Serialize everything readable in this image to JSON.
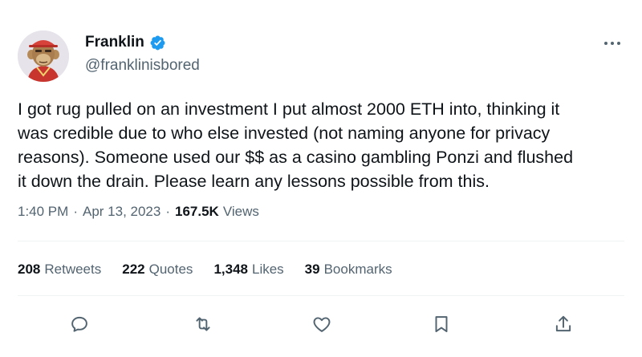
{
  "author": {
    "display_name": "Franklin",
    "handle": "@franklinisbored",
    "avatar_icon": "bored-ape-avatar",
    "verified": true,
    "verified_color": "#1d9bf0"
  },
  "tweet": {
    "text": "I got rug pulled on an investment I put almost 2000 ETH into, thinking it\nwas credible due to who else invested (not naming anyone for privacy\nreasons). Someone used our $$ as a casino gambling Ponzi and flushed\nit down the drain. Please learn any lessons possible from this.",
    "time": "1:40 PM",
    "separator": "·",
    "date": "Apr 13, 2023",
    "views_count": "167.5K",
    "views_label": "Views"
  },
  "stats": {
    "retweets": {
      "count": "208",
      "label": "Retweets"
    },
    "quotes": {
      "count": "222",
      "label": "Quotes"
    },
    "likes": {
      "count": "1,348",
      "label": "Likes"
    },
    "bookmarks": {
      "count": "39",
      "label": "Bookmarks"
    }
  },
  "actions": [
    {
      "icon": "reply-icon"
    },
    {
      "icon": "retweet-icon"
    },
    {
      "icon": "like-icon"
    },
    {
      "icon": "bookmark-icon"
    },
    {
      "icon": "share-icon"
    }
  ],
  "colors": {
    "text_primary": "#0f1419",
    "text_secondary": "#536471",
    "icon_gray": "#536471",
    "divider": "#eff3f4"
  }
}
